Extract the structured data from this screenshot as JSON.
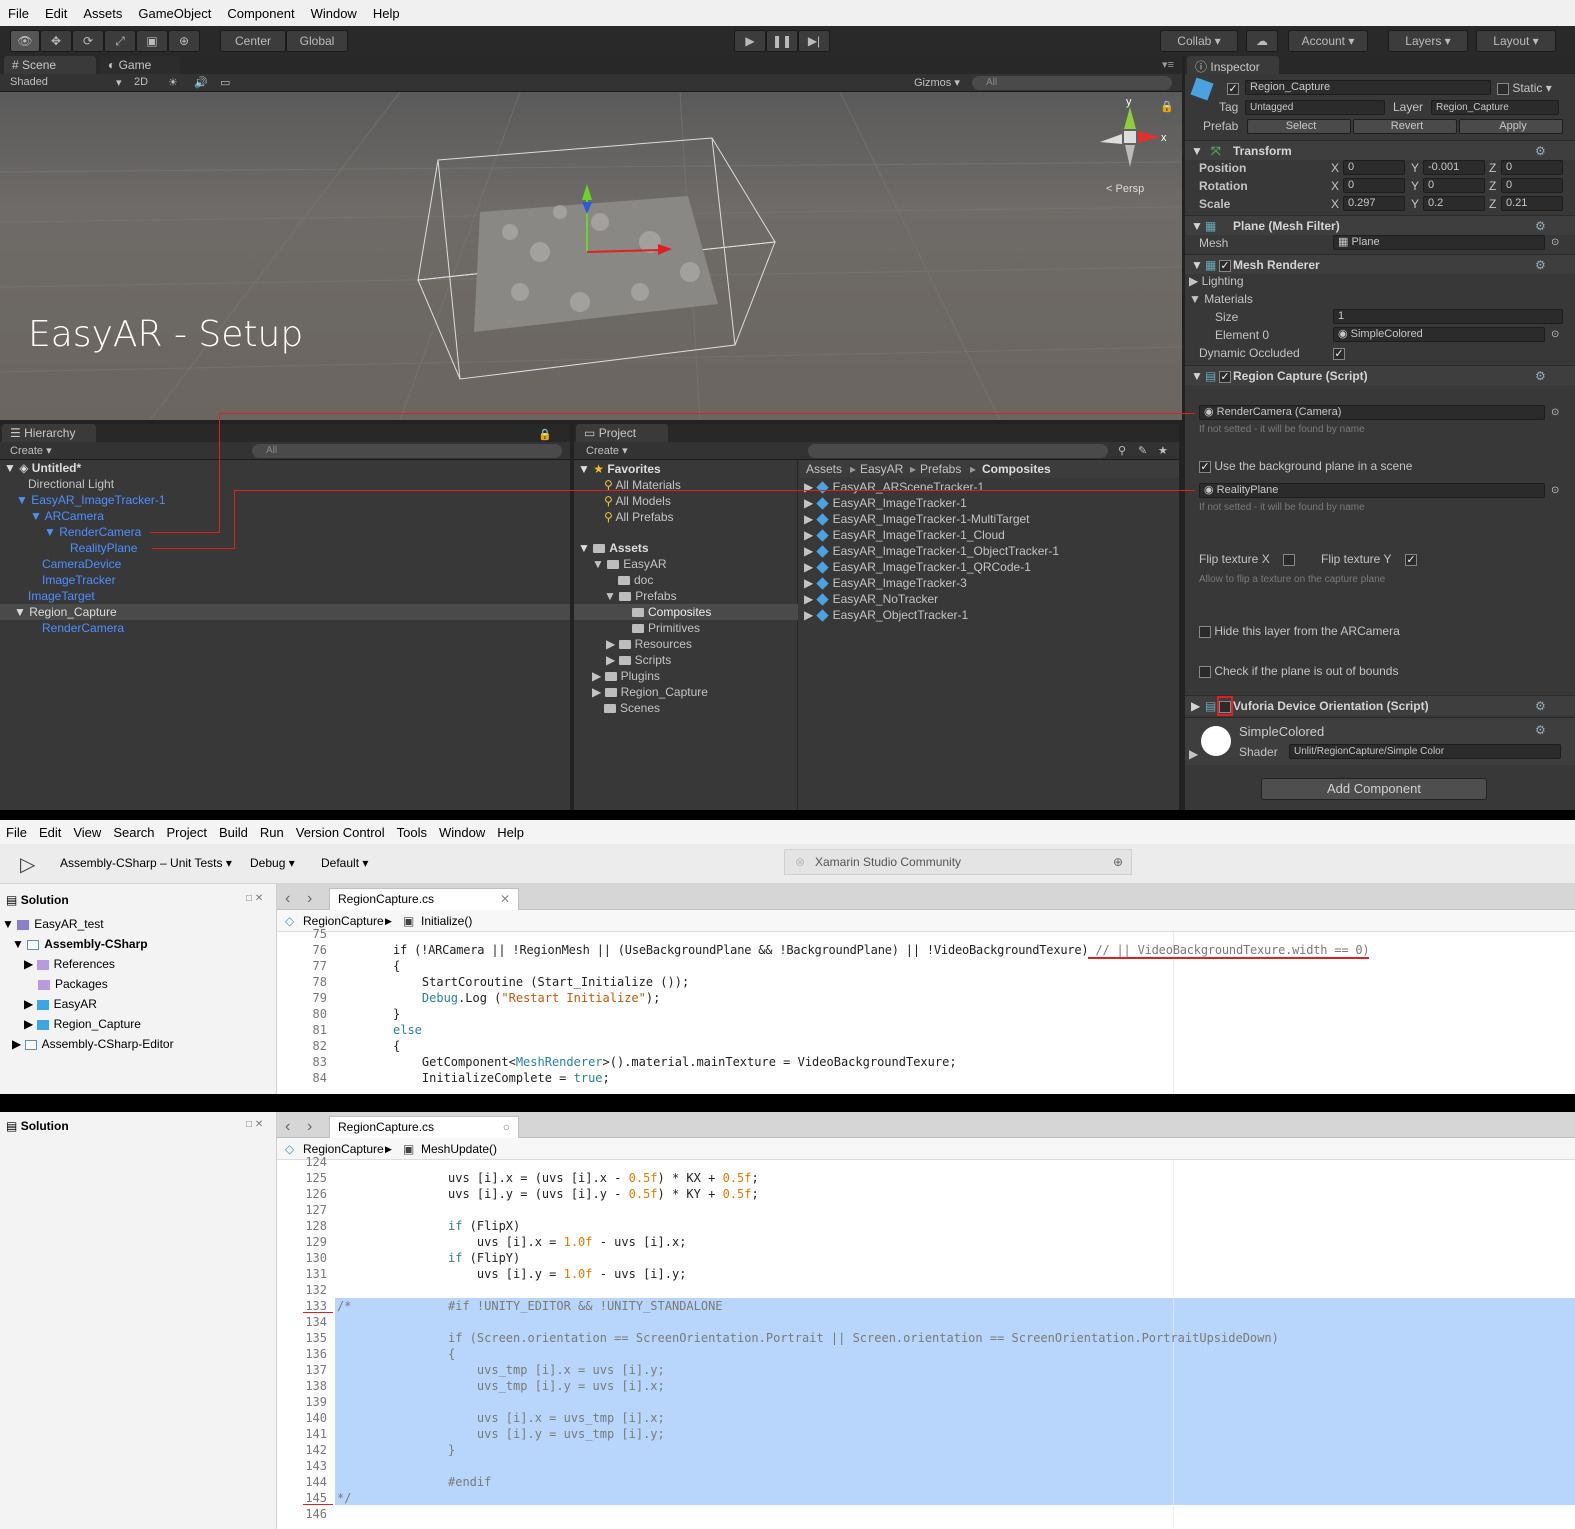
{
  "unity": {
    "menu": [
      "File",
      "Edit",
      "Assets",
      "GameObject",
      "Component",
      "Window",
      "Help"
    ],
    "toolbar": {
      "center": "Center",
      "global": "Global",
      "collab": "Collab",
      "account": "Account",
      "layers": "Layers",
      "layout": "Layout"
    },
    "scene": {
      "tab_scene": "Scene",
      "tab_game": "Game",
      "shaded": "Shaded",
      "mode_2d": "2D",
      "gizmos": "Gizmos",
      "search_placeholder": "All",
      "persp": "Persp",
      "overlay_title": "EasyAR - Setup",
      "axis_y": "y",
      "axis_x": "x"
    },
    "hierarchy": {
      "tab": "Hierarchy",
      "create": "Create",
      "search_placeholder": "All",
      "scene_name": "Untitled*",
      "items": [
        "Directional Light",
        "EasyAR_ImageTracker-1",
        "ARCamera",
        "RenderCamera",
        "RealityPlane",
        "CameraDevice",
        "ImageTracker",
        "ImageTarget",
        "Region_Capture",
        "RenderCamera"
      ]
    },
    "project": {
      "tab": "Project",
      "create": "Create",
      "favorites": "Favorites",
      "fav_items": [
        "All Materials",
        "All Models",
        "All Prefabs"
      ],
      "assets": "Assets",
      "tree": [
        "EasyAR",
        "doc",
        "Prefabs",
        "Composites",
        "Primitives",
        "Resources",
        "Scripts",
        "Plugins",
        "Region_Capture",
        "Scenes"
      ],
      "breadcrumb": [
        "Assets",
        "EasyAR",
        "Prefabs",
        "Composites"
      ],
      "files": [
        "EasyAR_ARSceneTracker-1",
        "EasyAR_ImageTracker-1",
        "EasyAR_ImageTracker-1-MultiTarget",
        "EasyAR_ImageTracker-1_Cloud",
        "EasyAR_ImageTracker-1_ObjectTracker-1",
        "EasyAR_ImageTracker-1_QRCode-1",
        "EasyAR_ImageTracker-3",
        "EasyAR_NoTracker",
        "EasyAR_ObjectTracker-1"
      ]
    },
    "inspector": {
      "tab": "Inspector",
      "object_name": "Region_Capture",
      "static": "Static",
      "tag_label": "Tag",
      "tag_value": "Untagged",
      "layer_label": "Layer",
      "layer_value": "Region_Capture",
      "prefab_label": "Prefab",
      "prefab_select": "Select",
      "prefab_revert": "Revert",
      "prefab_apply": "Apply",
      "transform": "Transform",
      "position": "Position",
      "rotation": "Rotation",
      "scale": "Scale",
      "pos": [
        "0",
        "-0.001",
        "0"
      ],
      "rot": [
        "0",
        "0",
        "0"
      ],
      "scl": [
        "0.297",
        "0.2",
        "0.21"
      ],
      "x": "X",
      "y": "Y",
      "z": "Z",
      "mesh_filter": "Plane (Mesh Filter)",
      "mesh_label": "Mesh",
      "mesh_value": "Plane",
      "mesh_renderer": "Mesh Renderer",
      "lighting": "Lighting",
      "materials": "Materials",
      "size_label": "Size",
      "size_value": "1",
      "element0_label": "Element 0",
      "element0_value": "SimpleColored",
      "dynamic_occluded": "Dynamic Occluded",
      "region_script": "Region Capture (Script)",
      "render_camera_value": "RenderCamera (Camera)",
      "hint_found": "If not setted - it will be found by name",
      "use_bg_plane": "Use the background plane in a scene",
      "reality_plane_value": "RealityPlane",
      "hint_found2": "If not setted - it will be found by name",
      "flip_x": "Flip texture X",
      "flip_y": "Flip texture Y",
      "flip_hint": "Allow to flip a texture on the capture plane",
      "hide_layer": "Hide this layer from the ARCamera",
      "check_bounds": "Check if the plane is out of bounds",
      "vuforia": "Vuforia Device Orientation (Script)",
      "material_name": "SimpleColored",
      "shader_label": "Shader",
      "shader_value": "Unlit/RegionCapture/Simple Color",
      "add_component": "Add Component"
    }
  },
  "xamarin": {
    "menu": [
      "File",
      "Edit",
      "View",
      "Search",
      "Project",
      "Build",
      "Run",
      "Version Control",
      "Tools",
      "Window",
      "Help"
    ],
    "config_project": "Assembly-CSharp – Unit Tests",
    "config_build": "Debug",
    "config_target": "Default",
    "status": "Xamarin Studio Community",
    "solution_title": "Solution",
    "solution_items": [
      "EasyAR_test",
      "Assembly-CSharp",
      "References",
      "Packages",
      "EasyAR",
      "Region_Capture",
      "Assembly-CSharp-Editor"
    ],
    "tab_file": "RegionCapture.cs",
    "bc_class": "RegionCapture",
    "bc_method1": "Initialize()",
    "bc_method2": "MeshUpdate()",
    "code1": {
      "lines": [
        "75",
        "76",
        "77",
        "78",
        "79",
        "80",
        "81",
        "82",
        "83",
        "84"
      ],
      "l76a": "if (!ARCamera || !RegionMesh || (UseBackgroundPlane && !BackgroundPlane) || !VideoBackgroundTexure)",
      "l76b": " // || VideoBackgroundTexure.width == 0)",
      "l77": "{",
      "l78": "    StartCoroutine (Start_Initialize ());",
      "l79a": "    Debug",
      "l79b": ".Log (",
      "l79c": "\"Restart Initialize\"",
      "l79d": ");",
      "l80": "}",
      "l81": "else",
      "l82": "{",
      "l83a": "    GetComponent<",
      "l83b": "MeshRenderer",
      "l83c": ">().material.mainTexture = VideoBackgroundTexure;",
      "l84a": "    InitializeComplete = ",
      "l84b": "true",
      "l84c": ";"
    },
    "code2": {
      "lines": [
        "124",
        "125",
        "126",
        "127",
        "128",
        "129",
        "130",
        "131",
        "132",
        "133",
        "134",
        "135",
        "136",
        "137",
        "138",
        "139",
        "140",
        "141",
        "142",
        "143",
        "144",
        "145",
        "146"
      ],
      "l125a": "uvs [i].x = (uvs [i].x - ",
      "l125b": "0.5f",
      "l125c": ") * KX + ",
      "l125d": "0.5f",
      "l125e": ";",
      "l126a": "uvs [i].y = (uvs [i].y - ",
      "l126b": "0.5f",
      "l126c": ") * KY + ",
      "l126d": "0.5f",
      "l126e": ";",
      "l128a": "if",
      "l128b": " (FlipX)",
      "l129a": "    uvs [i].x = ",
      "l129b": "1.0f",
      "l129c": " - uvs [i].x;",
      "l130a": "if",
      "l130b": " (FlipY)",
      "l131a": "    uvs [i].y = ",
      "l131b": "1.0f",
      "l131c": " - uvs [i].y;",
      "l133a": "/*",
      "l133b": "#if !UNITY_EDITOR && !UNITY_STANDALONE",
      "l135": "if (Screen.orientation == ScreenOrientation.Portrait || Screen.orientation == ScreenOrientation.PortraitUpsideDown)",
      "l136": "{",
      "l137": "    uvs_tmp [i].x = uvs [i].y;",
      "l138": "    uvs_tmp [i].y = uvs [i].x;",
      "l140": "    uvs [i].x = uvs_tmp [i].x;",
      "l141": "    uvs [i].y = uvs_tmp [i].y;",
      "l142": "}",
      "l144": "#endif",
      "l145": "*/"
    }
  }
}
